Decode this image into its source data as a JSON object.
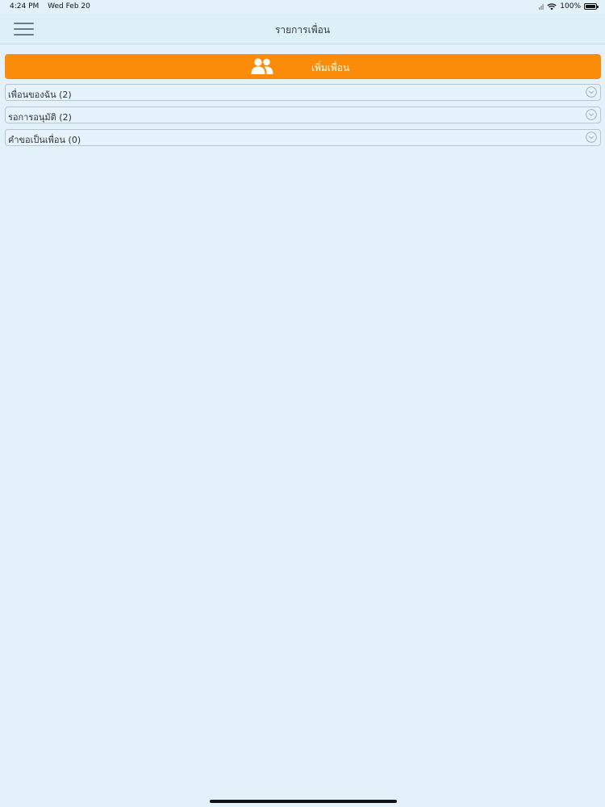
{
  "status_bar": {
    "time": "4:24 PM",
    "date": "Wed Feb 20",
    "battery": "100%"
  },
  "navbar": {
    "title": "รายการเพื่อน"
  },
  "add_friend": {
    "label": "เพิ่มเพื่อน",
    "icon": "users-icon"
  },
  "sections": [
    {
      "label": "เพื่อนของฉัน (2)"
    },
    {
      "label": "รอการอนุมัติ (2)"
    },
    {
      "label": "คำขอเป็นเพื่อน (0)"
    }
  ],
  "colors": {
    "accent": "#fb8c0a",
    "background": "#e3f1fb",
    "navbar": "#dbf0f7"
  }
}
